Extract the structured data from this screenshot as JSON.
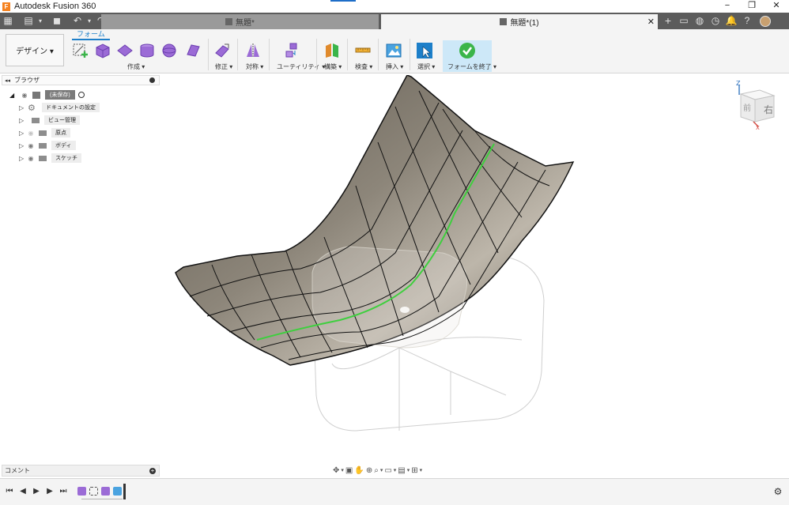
{
  "window": {
    "app_title": "Autodesk Fusion 360",
    "logo_letter": "F",
    "minimize": "−",
    "restore": "❐",
    "close": "✕"
  },
  "tabs": {
    "inactive_label": "無題*",
    "active_label": "無題*(1)",
    "close_glyph": "✕"
  },
  "tabbar_icons": [
    "grid-icon",
    "file-icon",
    "save-icon",
    "undo-icon",
    "redo-icon",
    "new-tab-icon",
    "chat-icon",
    "extensions-icon",
    "jobs-icon",
    "notifications-icon",
    "help-icon",
    "avatar"
  ],
  "toolbar": {
    "workspace": "デザイン ▾",
    "active_tab": "フォーム",
    "groups": {
      "create": "作成 ▾",
      "modify": "修正 ▾",
      "symmetry": "対称 ▾",
      "utility": "ユーティリティ ▾",
      "construct": "構築 ▾",
      "inspect": "検査 ▾",
      "insert": "挿入 ▾",
      "select": "選択 ▾",
      "finish": "フォームを終了 ▾"
    }
  },
  "browser": {
    "title": "ブラウザ",
    "collapse_glyph": "◂◂",
    "root_label": "(未保存)",
    "items": [
      {
        "label": "ドキュメントの設定"
      },
      {
        "label": "ビュー管理"
      },
      {
        "label": "原点"
      },
      {
        "label": "ボディ"
      },
      {
        "label": "スケッチ"
      }
    ]
  },
  "comment": {
    "label": "コメント",
    "add_glyph": "+"
  },
  "viewcube": {
    "face_right": "右",
    "face_front": "前",
    "axis_z": "Z",
    "axis_x": "X"
  },
  "nav_bar": {
    "icons": [
      "orbit-icon",
      "look-at-icon",
      "pan-icon",
      "zoom-icon",
      "fit-icon",
      "display-settings-icon",
      "grid-settings-icon",
      "viewports-icon"
    ]
  },
  "timeline": {
    "controls": [
      "skip-start",
      "step-back",
      "play",
      "step-forward",
      "skip-end"
    ],
    "settings_glyph": "⚙"
  },
  "colors": {
    "accent": "#1d7fc9",
    "form_purple": "#9b6bd6",
    "finish_green": "#3bb54a",
    "surface": "#827b70",
    "highlight_curve": "#3ecf3e",
    "ghost_body": "#cfcfcf"
  }
}
